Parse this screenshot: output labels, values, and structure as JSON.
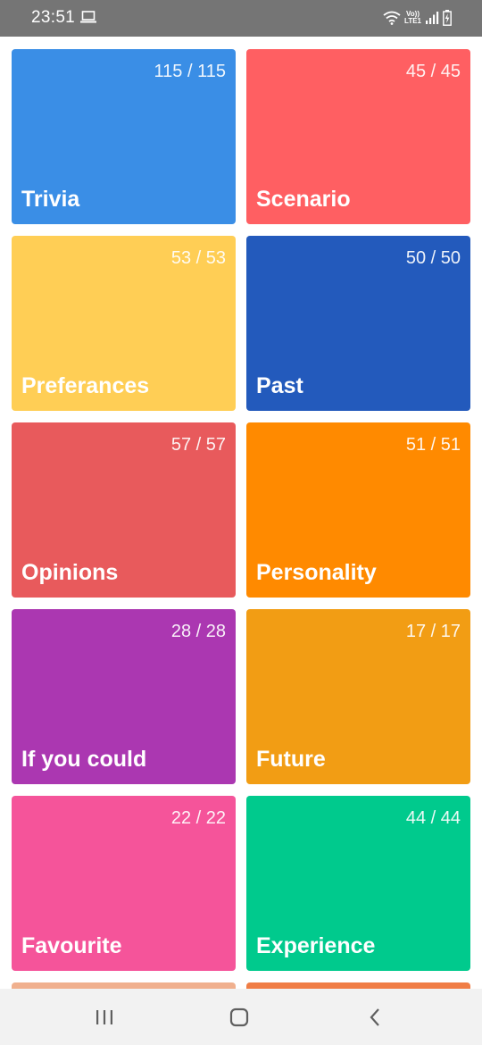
{
  "status_bar": {
    "time": "23:51",
    "network_label_top": "Vo))",
    "network_label_bottom": "LTE1"
  },
  "categories": [
    {
      "title": "Trivia",
      "count": "115 / 115",
      "color": "#3A8EE6"
    },
    {
      "title": "Scenario",
      "count": "45 / 45",
      "color": "#FF5F62"
    },
    {
      "title": "Preferances",
      "count": "53 / 53",
      "color": "#FFCE55"
    },
    {
      "title": "Past",
      "count": "50 / 50",
      "color": "#235ABC"
    },
    {
      "title": "Opinions",
      "count": "57 / 57",
      "color": "#E85A5C"
    },
    {
      "title": "Personality",
      "count": "51 / 51",
      "color": "#FF8A00"
    },
    {
      "title": "If you could",
      "count": "28 / 28",
      "color": "#AB37B1"
    },
    {
      "title": "Future",
      "count": "17 / 17",
      "color": "#F29D14"
    },
    {
      "title": "Favourite",
      "count": "22 / 22",
      "color": "#F5549A"
    },
    {
      "title": "Experience",
      "count": "44 / 44",
      "color": "#00CA8D"
    },
    {
      "title": "",
      "count": "",
      "color": "#F0B08E"
    },
    {
      "title": "",
      "count": "",
      "color": "#F07D45"
    }
  ],
  "nav": {
    "recents": "recents-icon",
    "home": "home-icon",
    "back": "back-icon"
  }
}
